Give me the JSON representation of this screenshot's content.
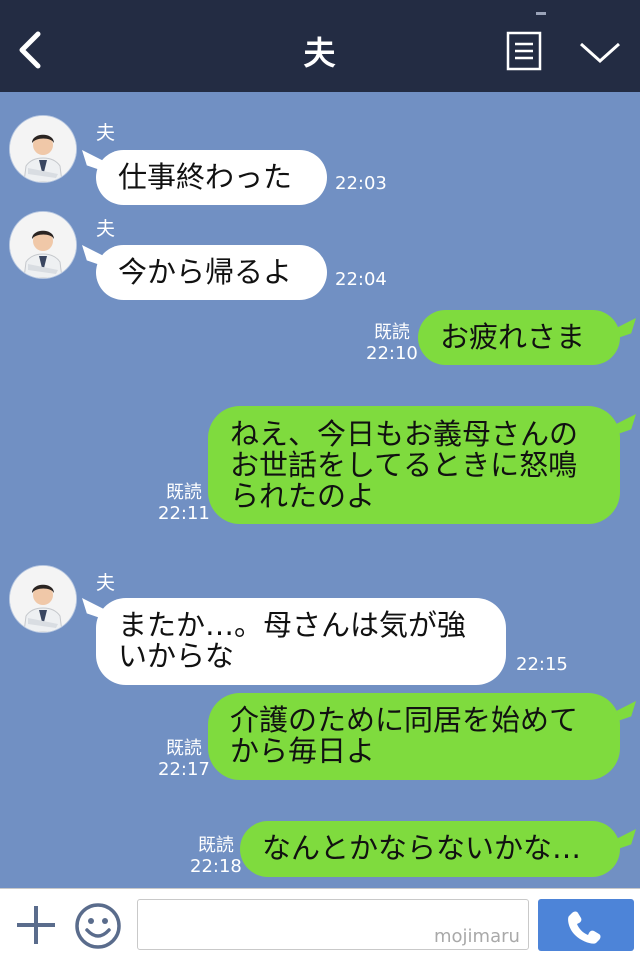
{
  "header": {
    "title": "夫",
    "colors": {
      "background": "#232c43",
      "chat_background": "#7190c3"
    }
  },
  "colors": {
    "incoming_bubble": "#ffffff",
    "outgoing_bubble": "#7fdb3e",
    "call_button": "#4d84d8"
  },
  "messages": [
    {
      "direction": "in",
      "sender": "夫",
      "lines": [
        "仕事終わった"
      ],
      "time": "22:03"
    },
    {
      "direction": "in",
      "sender": "夫",
      "lines": [
        "今から帰るよ"
      ],
      "time": "22:04"
    },
    {
      "direction": "out",
      "read": "既読",
      "lines": [
        "お疲れさま"
      ],
      "time": "22:10"
    },
    {
      "direction": "out",
      "read": "既読",
      "lines": [
        "ねえ、今日もお義母さんの",
        "お世話をしてるときに怒鳴",
        "られたのよ"
      ],
      "time": "22:11"
    },
    {
      "direction": "in",
      "sender": "夫",
      "lines": [
        "またか…。母さんは気が強",
        "いからな"
      ],
      "time": "22:15"
    },
    {
      "direction": "out",
      "read": "既読",
      "lines": [
        "介護のために同居を始めて",
        "から毎日よ"
      ],
      "time": "22:17"
    },
    {
      "direction": "out",
      "read": "既読",
      "lines": [
        "なんとかならないかな…"
      ],
      "time": "22:18"
    }
  ],
  "input": {
    "placeholder": "",
    "watermark": "mojimaru"
  },
  "icons": {
    "back": "chevron-left-icon",
    "menu": "document-menu-icon",
    "collapse": "chevron-down-icon",
    "plus": "plus-icon",
    "emoji": "smiley-icon",
    "call": "phone-icon"
  }
}
